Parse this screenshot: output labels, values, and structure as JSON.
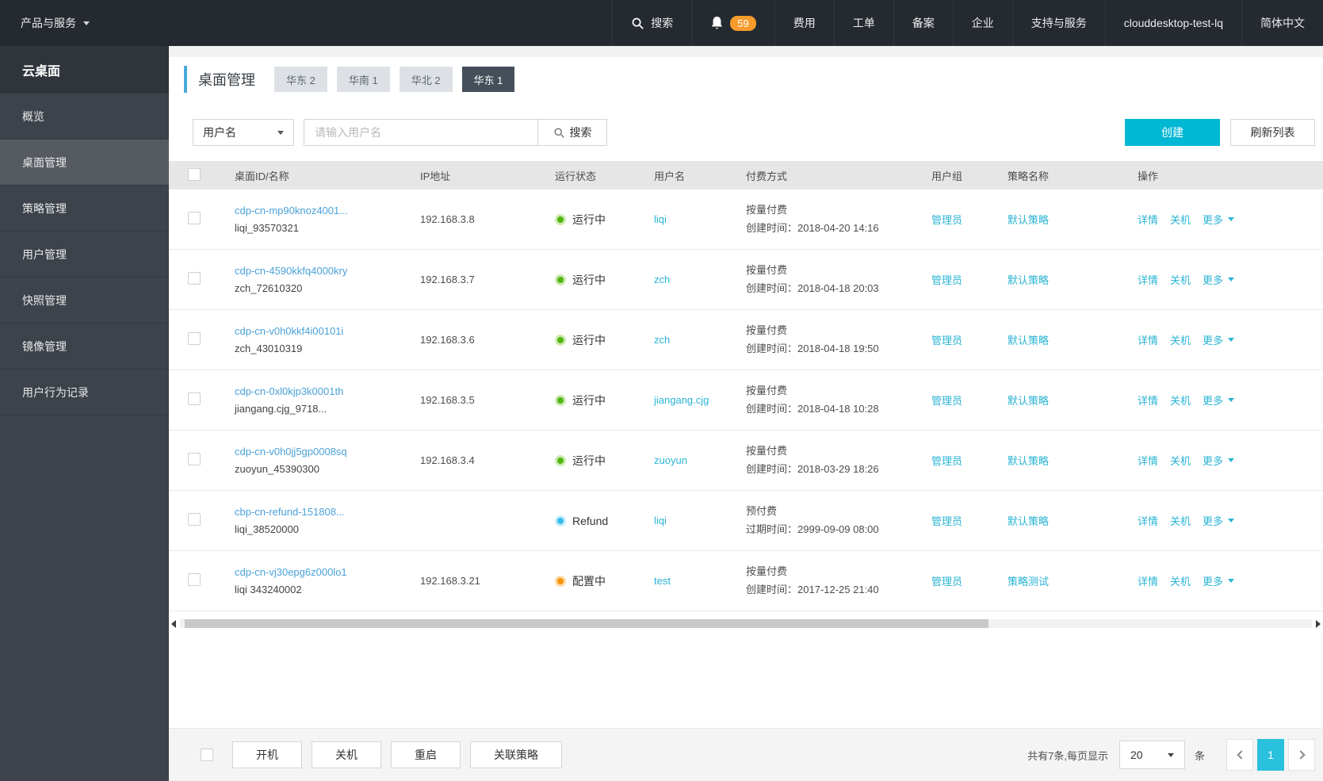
{
  "topbar": {
    "product_menu": "产品与服务",
    "search_label": "搜索",
    "notification_count": "59",
    "nav_items": [
      "费用",
      "工单",
      "备案",
      "企业",
      "支持与服务"
    ],
    "account_name": "clouddesktop-test-lq",
    "language": "简体中文"
  },
  "sidebar": {
    "title": "云桌面",
    "items": [
      {
        "label": "概览",
        "active": false
      },
      {
        "label": "桌面管理",
        "active": true
      },
      {
        "label": "策略管理",
        "active": false
      },
      {
        "label": "用户管理",
        "active": false
      },
      {
        "label": "快照管理",
        "active": false
      },
      {
        "label": "镜像管理",
        "active": false
      },
      {
        "label": "用户行为记录",
        "active": false
      }
    ]
  },
  "page": {
    "title": "桌面管理",
    "region_tabs": [
      {
        "label": "华东 2",
        "active": false
      },
      {
        "label": "华南 1",
        "active": false
      },
      {
        "label": "华北 2",
        "active": false
      },
      {
        "label": "华东 1",
        "active": true
      }
    ]
  },
  "toolbar": {
    "filter_selected": "用户名",
    "input_placeholder": "请输入用户名",
    "search_button": "搜索",
    "create_button": "创建",
    "refresh_button": "刷新列表"
  },
  "table": {
    "columns": [
      "桌面ID/名称",
      "IP地址",
      "运行状态",
      "用户名",
      "付费方式",
      "用户组",
      "策略名称",
      "操作"
    ],
    "action_labels": [
      "详情",
      "关机",
      "更多"
    ],
    "rows": [
      {
        "id": "cdp-cn-mp90knoz4001...",
        "name": "liqi_93570321",
        "ip": "192.168.3.8",
        "status": "运行中",
        "status_kind": "running",
        "user": "liqi",
        "pay_type": "按量付费",
        "pay_detail": "创建时间：2018-04-20 14:16",
        "group": "管理员",
        "policy": "默认策略"
      },
      {
        "id": "cdp-cn-4590kkfq4000kry",
        "name": "zch_72610320",
        "ip": "192.168.3.7",
        "status": "运行中",
        "status_kind": "running",
        "user": "zch",
        "pay_type": "按量付费",
        "pay_detail": "创建时间：2018-04-18 20:03",
        "group": "管理员",
        "policy": "默认策略"
      },
      {
        "id": "cdp-cn-v0h0kkf4i00101i",
        "name": "zch_43010319",
        "ip": "192.168.3.6",
        "status": "运行中",
        "status_kind": "running",
        "user": "zch",
        "pay_type": "按量付费",
        "pay_detail": "创建时间：2018-04-18 19:50",
        "group": "管理员",
        "policy": "默认策略"
      },
      {
        "id": "cdp-cn-0xl0kjp3k0001th",
        "name": "jiangang.cjg_9718...",
        "ip": "192.168.3.5",
        "status": "运行中",
        "status_kind": "running",
        "user": "jiangang.cjg",
        "pay_type": "按量付费",
        "pay_detail": "创建时间：2018-04-18 10:28",
        "group": "管理员",
        "policy": "默认策略"
      },
      {
        "id": "cdp-cn-v0h0jj5gp0008sq",
        "name": "zuoyun_45390300",
        "ip": "192.168.3.4",
        "status": "运行中",
        "status_kind": "running",
        "user": "zuoyun",
        "pay_type": "按量付费",
        "pay_detail": "创建时间：2018-03-29 18:26",
        "group": "管理员",
        "policy": "默认策略"
      },
      {
        "id": "cbp-cn-refund-151808...",
        "name": "liqi_38520000",
        "ip": "",
        "status": "Refund",
        "status_kind": "refund",
        "user": "liqi",
        "pay_type": "预付费",
        "pay_detail": "过期时间：2999-09-09 08:00",
        "group": "管理员",
        "policy": "默认策略"
      },
      {
        "id": "cdp-cn-vj30epg6z000lo1",
        "name": "liqi 343240002",
        "ip": "192.168.3.21",
        "status": "配置中",
        "status_kind": "configuring",
        "user": "test",
        "pay_type": "按量付费",
        "pay_detail": "创建时间：2017-12-25 21:40",
        "group": "管理员",
        "policy": "策略测试"
      }
    ]
  },
  "footer": {
    "batch_buttons": [
      "开机",
      "关机",
      "重启",
      "关联策略"
    ],
    "total_text": "共有7条,每页显示",
    "page_size": "20",
    "unit_label": "条",
    "current_page": "1"
  },
  "colors": {
    "accent_cyan": "#00b8d4",
    "id_link_blue": "#4aa1d9",
    "link_cyan": "#29b4d4",
    "status_running_green": "#52b513",
    "status_refund_blue": "#35bce8",
    "status_configuring_orange": "#f7930e",
    "badge_orange": "#f79b2b",
    "topbar_bg": "#252a31",
    "sidebar_bg": "#3d434b"
  }
}
